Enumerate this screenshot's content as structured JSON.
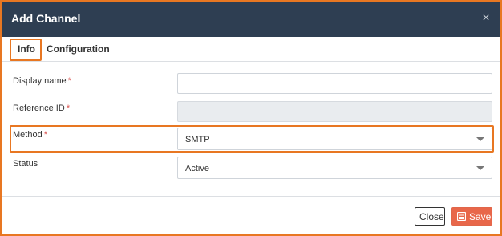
{
  "dialog": {
    "title": "Add Channel",
    "close_icon": "close-icon"
  },
  "tabs": [
    {
      "label": "Info",
      "active": true
    },
    {
      "label": "Configuration",
      "active": false
    }
  ],
  "form": {
    "display_name": {
      "label": "Display name",
      "required_mark": "*",
      "value": ""
    },
    "reference_id": {
      "label": "Reference ID",
      "required_mark": "*",
      "value": ""
    },
    "method": {
      "label": "Method",
      "required_mark": "*",
      "value": "SMTP"
    },
    "status": {
      "label": "Status",
      "value": "Active"
    }
  },
  "footer": {
    "close_label": "Close",
    "save_label": "Save",
    "save_icon": "save-icon"
  },
  "colors": {
    "header_bg": "#2e3e52",
    "highlight": "#e87722",
    "save_button": "#e8674a",
    "required": "#d9534f"
  }
}
